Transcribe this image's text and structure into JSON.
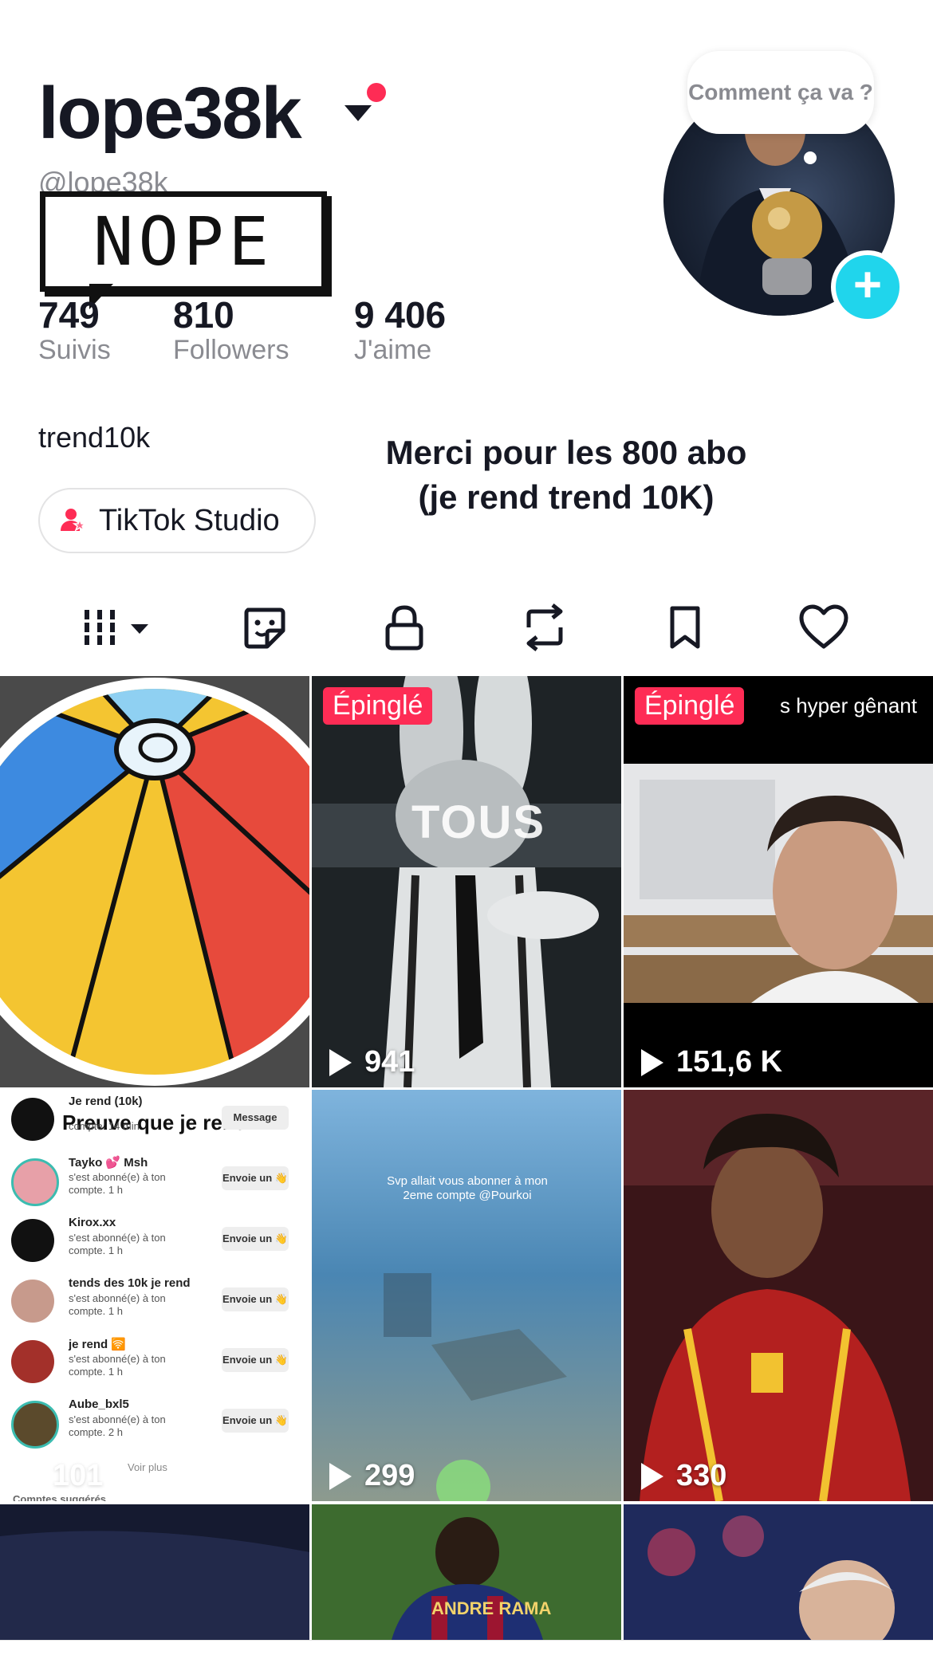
{
  "profile": {
    "display_name": "lope38k",
    "handle": "@lope38k",
    "sticker_text": "NOPE",
    "bio": "trend10k",
    "studio_button": "TikTok Studio",
    "caption_line1": "Merci pour les 800 abo",
    "caption_line2": "(je rend trend 10K)",
    "avatar_bubble": "Comment ça va ?",
    "stats": [
      {
        "value": "749",
        "label": "Suivis"
      },
      {
        "value": "810",
        "label": "Followers"
      },
      {
        "value": "9 406",
        "label": "J'aime"
      }
    ]
  },
  "tabs": [
    {
      "icon": "grid-icon"
    },
    {
      "icon": "sticker-icon"
    },
    {
      "icon": "lock-icon"
    },
    {
      "icon": "repost-icon"
    },
    {
      "icon": "bookmark-icon"
    },
    {
      "icon": "heart-icon"
    }
  ],
  "videos": [
    {
      "pinned": "",
      "views": "",
      "overlay": ""
    },
    {
      "pinned": "Épinglé",
      "views": "941",
      "overlay": "TOUS"
    },
    {
      "pinned": "Épinglé",
      "views": "151,6 K",
      "overlay": "s hyper gênant"
    },
    {
      "pinned": "",
      "views": "101",
      "overlay": "Preuve que je rend"
    },
    {
      "pinned": "",
      "views": "299",
      "overlay": "Svp allait vous abonner à mon 2eme compte @Pourkoi"
    },
    {
      "pinned": "",
      "views": "330",
      "overlay": ""
    }
  ],
  "notifications": {
    "items": [
      {
        "name": "Je rend (10k)",
        "text": "compte. 14 min",
        "button": "Message"
      },
      {
        "name": "Tayko 💕 Msh",
        "text": "s'est abonné(e) à ton compte. 1 h",
        "button": "Envoie un 👋"
      },
      {
        "name": "Kirox.xx",
        "text": "s'est abonné(e) à ton compte. 1 h",
        "button": "Envoie un 👋"
      },
      {
        "name": "tends des 10k je rend",
        "text": "s'est abonné(e) à ton compte. 1 h",
        "button": "Envoie un 👋"
      },
      {
        "name": "je rend 🛜",
        "text": "s'est abonné(e) à ton compte. 1 h",
        "button": "Envoie un 👋"
      },
      {
        "name": "Aube_bxl5",
        "text": "s'est abonné(e) à ton compte. 2 h",
        "button": "Envoie un 👋"
      }
    ],
    "see_more": "Voir plus",
    "suggested": "Comptes suggérés"
  },
  "jersey_text": "ANDRE RAMA",
  "colors": {
    "accent": "#fe2c55",
    "plus": "#20d5ec"
  }
}
